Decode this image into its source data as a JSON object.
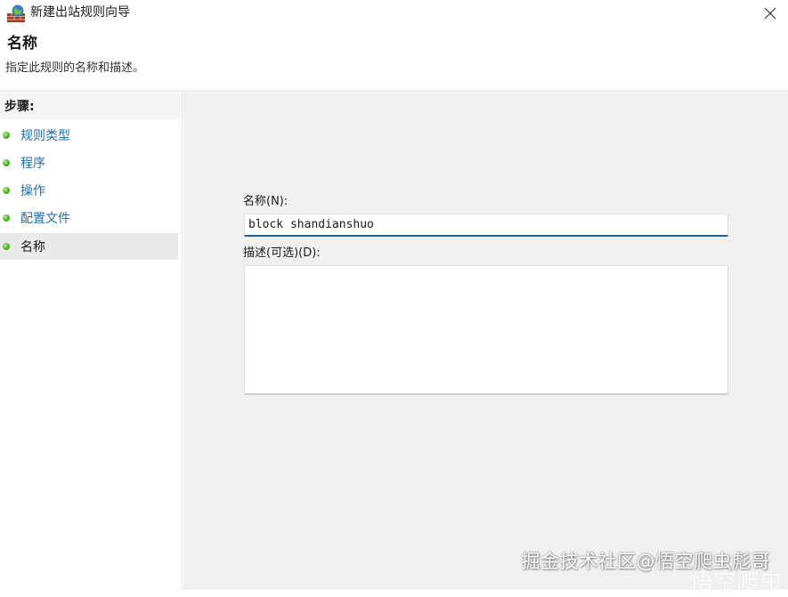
{
  "window": {
    "title": "新建出站规则向导",
    "app_icon": "firewall-wall-globe-icon",
    "close_icon": "close-icon"
  },
  "header": {
    "title": "名称",
    "description": "指定此规则的名称和描述。"
  },
  "sidebar": {
    "steps_label": "步骤:",
    "items": [
      {
        "label": "规则类型",
        "state": "done"
      },
      {
        "label": "程序",
        "state": "done"
      },
      {
        "label": "操作",
        "state": "done"
      },
      {
        "label": "配置文件",
        "state": "done"
      },
      {
        "label": "名称",
        "state": "current"
      }
    ],
    "dot_color": "#4fb21b"
  },
  "form": {
    "name_label": "名称(N):",
    "name_value": "block shandianshuo",
    "description_label": "描述(可选)(D):",
    "description_value": ""
  },
  "watermark": {
    "text": "掘金技术社区@悟空爬虫彪哥",
    "faint_text": "悟空爬虫"
  },
  "colors": {
    "accent": "#1f5fa0",
    "link": "#1f6fa8",
    "panel": "#f0f0f0"
  }
}
